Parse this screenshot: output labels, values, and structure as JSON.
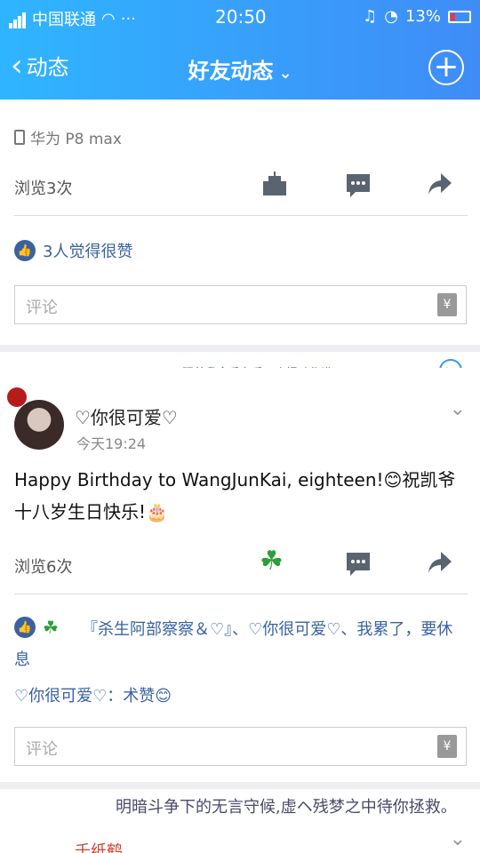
{
  "status_bar": {
    "carrier": "中国联通",
    "time": "20:50",
    "battery": "13%"
  },
  "nav": {
    "back_label": "动态",
    "title": "好友动态"
  },
  "post1": {
    "device": "华为 P8 max",
    "views": "浏览3次",
    "likes": "3人觉得很赞",
    "comment_placeholder": "评论"
  },
  "banner": {
    "text": "跟着我全手右手一个慢动作哟"
  },
  "post2": {
    "username": "♡你很可爱♡",
    "time": "今天19:24",
    "content": "Happy Birthday to WangJunKai, eighteen!😊祝凯爷十八岁生日快乐!🎂",
    "views": "浏览6次",
    "likers": "『杀生阿部察察＆♡』、♡你很可爱♡、我累了，要休息",
    "reply": "♡你很可爱♡：术赞😊",
    "comment_placeholder": "评论"
  },
  "bottom": {
    "strip": "明暗斗争下的无言守候,虚ヘ残梦之中待你拯救。",
    "next_user": "千纸鹤"
  },
  "colors": {
    "header_start": "#2fb5ff",
    "header_end": "#3f8cf7",
    "link": "#3a62a0",
    "clover": "#2e9e3a"
  }
}
